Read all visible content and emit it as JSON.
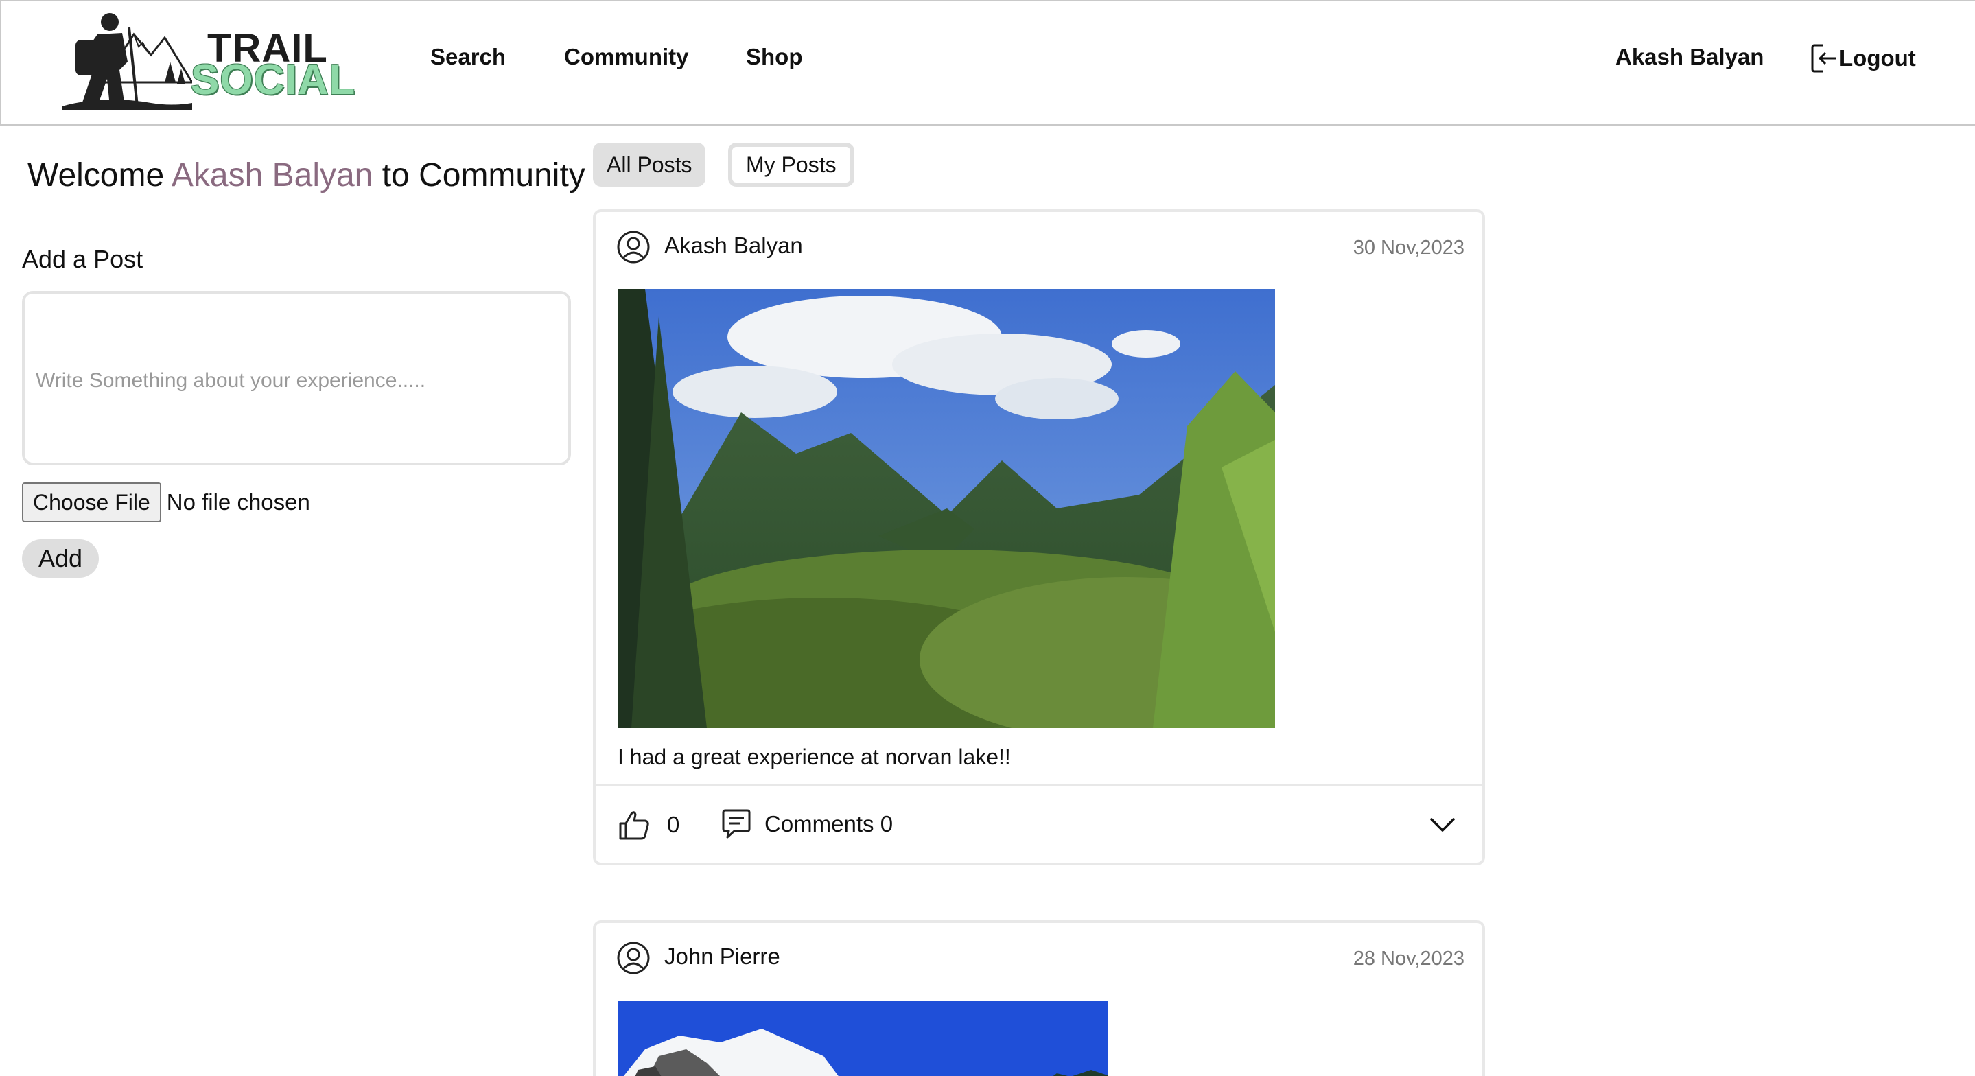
{
  "header": {
    "logo_line1": "TRAIL",
    "logo_line2": "SOCIAL",
    "nav": {
      "search": "Search",
      "community": "Community",
      "shop": "Shop"
    },
    "user_name": "Akash Balyan",
    "logout_label": "Logout"
  },
  "sidebar": {
    "welcome_prefix": "Welcome ",
    "welcome_name": "Akash Balyan",
    "welcome_suffix": " to Community",
    "add_post_title": "Add a Post",
    "post_placeholder": "Write Something about your experience.....",
    "file_button_label": "Choose File",
    "file_status": "No file chosen",
    "add_button_label": "Add"
  },
  "tabs": {
    "all_posts": "All Posts",
    "my_posts": "My Posts"
  },
  "posts": [
    {
      "author": "Akash Balyan",
      "date": "30 Nov,2023",
      "caption": "I had a great experience at norvan lake!!",
      "likes": "0",
      "comments_label": "Comments 0"
    },
    {
      "author": "John Pierre",
      "date": "28 Nov,2023"
    }
  ],
  "colors": {
    "accent_name": "#8a6a80",
    "logo_green": "#8fd9a8",
    "border": "#e8e8e8"
  },
  "icons": {
    "user": "user-circle-icon",
    "like": "thumbs-up-icon",
    "comment": "comment-icon",
    "expand": "chevron-down-icon",
    "logout": "logout-icon"
  }
}
